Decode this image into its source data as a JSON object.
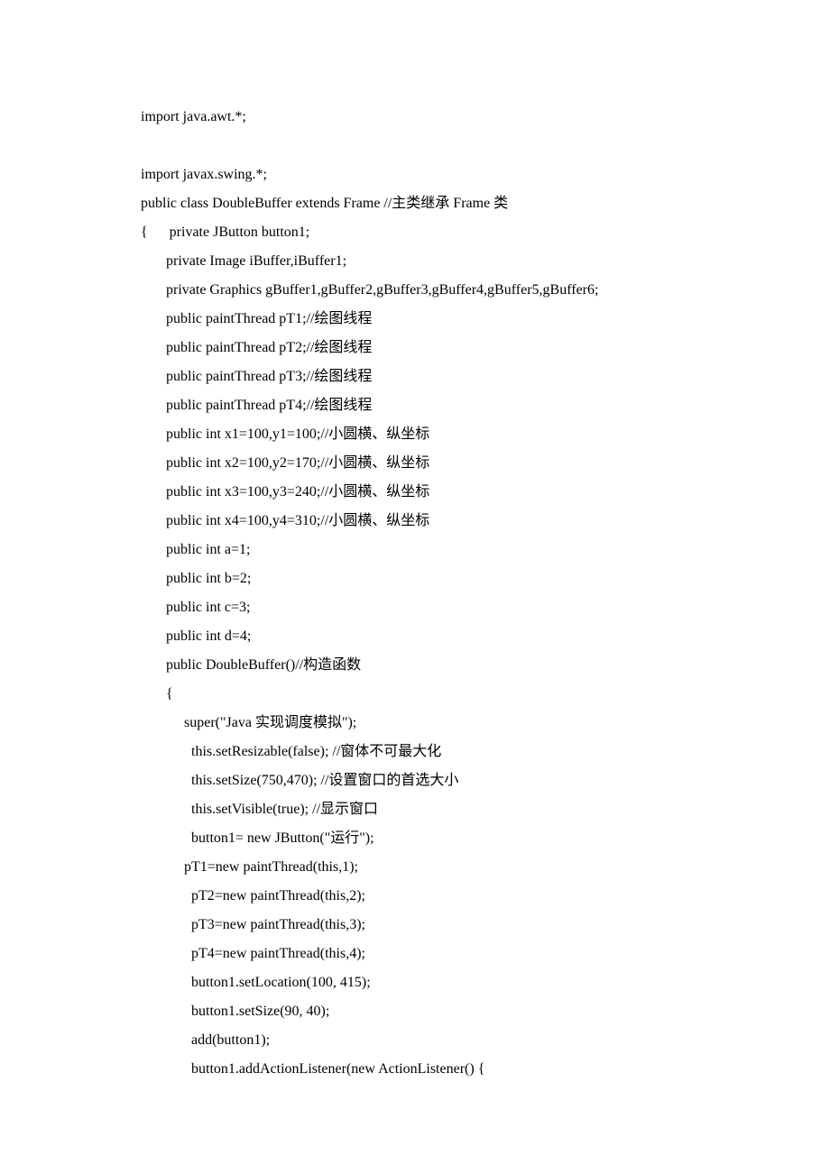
{
  "lines": [
    "import java.awt.*;",
    "",
    "import javax.swing.*;",
    "public class DoubleBuffer extends Frame //主类继承 Frame 类",
    "{      private JButton button1;",
    "       private Image iBuffer,iBuffer1;",
    "       private Graphics gBuffer1,gBuffer2,gBuffer3,gBuffer4,gBuffer5,gBuffer6;",
    "       public paintThread pT1;//绘图线程",
    "       public paintThread pT2;//绘图线程",
    "       public paintThread pT3;//绘图线程",
    "       public paintThread pT4;//绘图线程",
    "       public int x1=100,y1=100;//小圆横、纵坐标",
    "       public int x2=100,y2=170;//小圆横、纵坐标",
    "       public int x3=100,y3=240;//小圆横、纵坐标",
    "       public int x4=100,y4=310;//小圆横、纵坐标",
    "       public int a=1;",
    "       public int b=2;",
    "       public int c=3;",
    "       public int d=4;",
    "       public DoubleBuffer()//构造函数",
    "       {",
    "            super(\"Java 实现调度模拟\");",
    "              this.setResizable(false); //窗体不可最大化",
    "              this.setSize(750,470); //设置窗口的首选大小",
    "              this.setVisible(true); //显示窗口",
    "              button1= new JButton(\"运行\");",
    "            pT1=new paintThread(this,1);",
    "              pT2=new paintThread(this,2);",
    "              pT3=new paintThread(this,3);",
    "              pT4=new paintThread(this,4);",
    "              button1.setLocation(100, 415);",
    "              button1.setSize(90, 40);",
    "              add(button1);",
    "              button1.addActionListener(new ActionListener() {"
  ]
}
